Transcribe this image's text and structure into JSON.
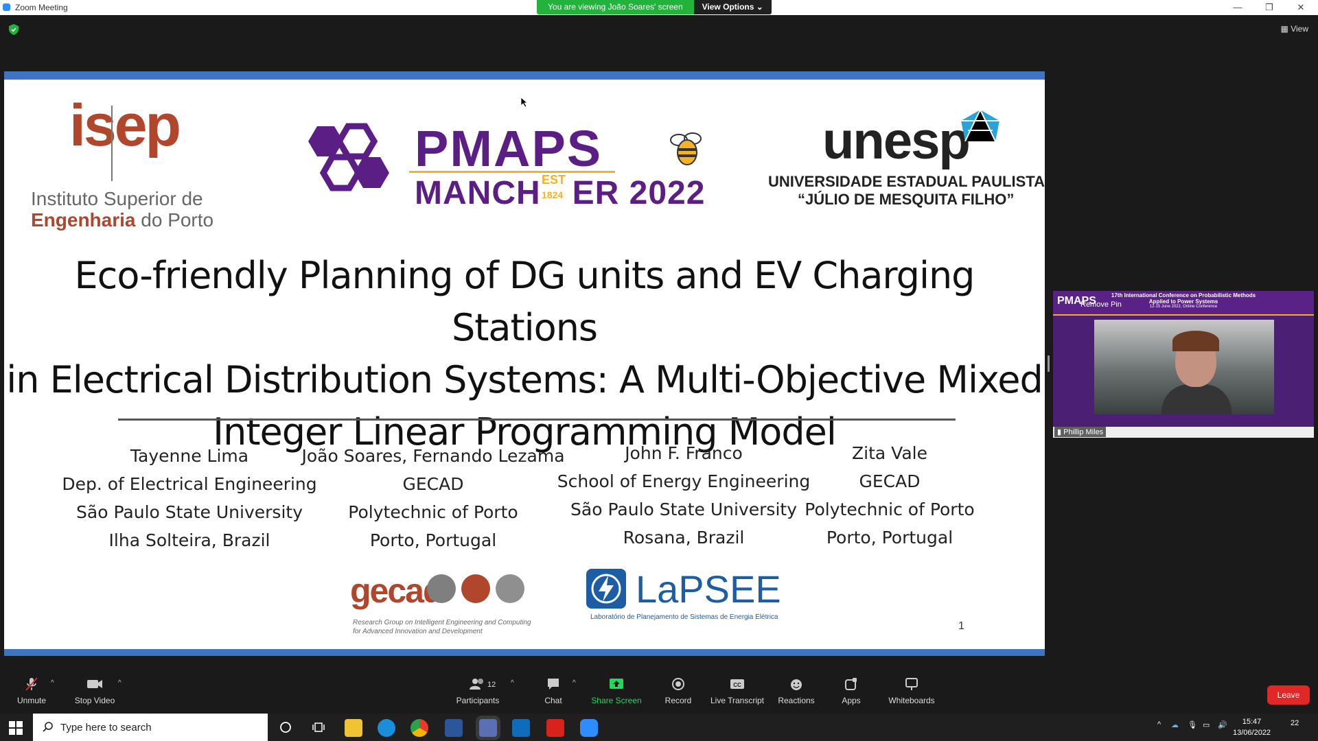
{
  "window": {
    "title": "Zoom Meeting",
    "minimize": "—",
    "restore": "❐",
    "close": "✕"
  },
  "banner": {
    "viewing": "You are viewing João Soares' screen",
    "view_options": "View Options ⌄"
  },
  "topbar": {
    "view_label": "View"
  },
  "slide": {
    "isep": {
      "logo": "isep",
      "line1": "Instituto Superior de",
      "line2_strong": "Engenharia",
      "line2_rest": " do Porto"
    },
    "pmaps": {
      "title": "PMAPS",
      "subtitle_a": "MANCH",
      "subtitle_b": "ER 2022",
      "est": "EST",
      "year": "1824"
    },
    "unesp": {
      "logo": "unesp",
      "line1": "UNIVERSIDADE ESTADUAL PAULISTA",
      "line2": "“JÚLIO DE MESQUITA FILHO”"
    },
    "title_lines": [
      "Eco-friendly Planning of DG units and EV Charging Stations",
      "in Electrical Distribution Systems: A Multi-Objective Mixed",
      "Integer Linear Programming Model"
    ],
    "authors": [
      {
        "name": "Tayenne Lima",
        "dept": "Dep. of Electrical Engineering",
        "inst": "São Paulo State University",
        "loc": "Ilha Solteira, Brazil"
      },
      {
        "name": "João Soares, Fernando Lezama",
        "dept": "GECAD",
        "inst": "Polytechnic of Porto",
        "loc": "Porto, Portugal"
      },
      {
        "name": "John F. Franco",
        "dept": "School of Energy Engineering",
        "inst": "São Paulo State University",
        "loc": "Rosana, Brazil"
      },
      {
        "name": "Zita Vale",
        "dept": "GECAD",
        "inst": "Polytechnic of Porto",
        "loc": "Porto, Portugal"
      }
    ],
    "gecad": {
      "logo": "gecad",
      "desc1": "Research Group on Intelligent Engineering and Computing",
      "desc2": "for Advanced Innovation and Development"
    },
    "lapsee": {
      "logo": "LaPSEE",
      "desc": "Laboratório de Planejamento de Sistemas de Energia Elétrica"
    },
    "page_number": "1"
  },
  "participant": {
    "remove_pin": "Remove Pin",
    "conference_line1": "17th International Conference on Probabilistic Methods",
    "conference_line2": "Applied to Power Systems",
    "conference_line3": "12-15 June 2022, Online Conference",
    "banner_logo": "PMAPS",
    "name": "Phillip Miles"
  },
  "toolbar": {
    "unmute": "Unmute",
    "stop_video": "Stop Video",
    "participants": "Participants",
    "participants_count": "12",
    "chat": "Chat",
    "share_screen": "Share Screen",
    "record": "Record",
    "live_transcript": "Live Transcript",
    "reactions": "Reactions",
    "apps": "Apps",
    "whiteboards": "Whiteboards",
    "leave": "Leave"
  },
  "taskbar": {
    "search_placeholder": "Type here to search",
    "time": "15:47",
    "date": "13/06/2022",
    "notifications": "22"
  },
  "colors": {
    "zoom_blue": "#2d8cff",
    "banner_green": "#23b23b",
    "slide_bar": "#3f74c2",
    "isep_red": "#b0462c",
    "pmaps_purple": "#5a1e84",
    "pmaps_gold": "#f3b229",
    "leave_red": "#e02828"
  }
}
